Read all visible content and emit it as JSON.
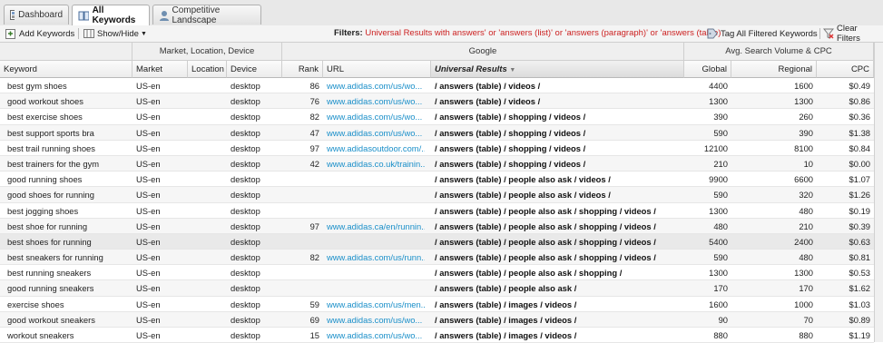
{
  "tabs": [
    {
      "label": "Dashboard",
      "icon": "dashboard-icon"
    },
    {
      "label": "All Keywords",
      "icon": "keywords-book-icon",
      "active": true
    },
    {
      "label": "Competitive Landscape",
      "icon": "competitive-landscape-icon"
    }
  ],
  "toolbar": {
    "add_keywords": "Add Keywords",
    "show_hide": "Show/Hide",
    "filters_label": "Filters:",
    "filters_value": "Universal Results with answers' or 'answers (list)' or 'answers (paragraph)' or 'answers (table)",
    "tag_all": "Tag All Filtered Keywords",
    "clear_filters": "Clear Filters"
  },
  "groups": {
    "market": "Market, Location, Device",
    "google": "Google",
    "volume": "Avg. Search Volume & CPC"
  },
  "columns": {
    "keyword": "Keyword",
    "market": "Market",
    "location": "Location",
    "device": "Device",
    "rank": "Rank",
    "url": "URL",
    "universal": "Universal Results",
    "global": "Global",
    "regional": "Regional",
    "cpc": "CPC"
  },
  "rows": [
    {
      "keyword": "best gym shoes",
      "market": "US-en",
      "location": "",
      "device": "desktop",
      "rank": "86",
      "url": "www.adidas.com/us/wo...",
      "universal": "/ answers (table) / videos /",
      "global": "4400",
      "regional": "1600",
      "cpc": "$0.49"
    },
    {
      "keyword": "good workout shoes",
      "market": "US-en",
      "location": "",
      "device": "desktop",
      "rank": "76",
      "url": "www.adidas.com/us/wo...",
      "universal": "/ answers (table) / videos /",
      "global": "1300",
      "regional": "1300",
      "cpc": "$0.86"
    },
    {
      "keyword": "best exercise shoes",
      "market": "US-en",
      "location": "",
      "device": "desktop",
      "rank": "82",
      "url": "www.adidas.com/us/wo...",
      "universal": "/ answers (table) / shopping / videos /",
      "global": "390",
      "regional": "260",
      "cpc": "$0.36"
    },
    {
      "keyword": "best support sports bra",
      "market": "US-en",
      "location": "",
      "device": "desktop",
      "rank": "47",
      "url": "www.adidas.com/us/wo...",
      "universal": "/ answers (table) / shopping / videos /",
      "global": "590",
      "regional": "390",
      "cpc": "$1.38"
    },
    {
      "keyword": "best trail running shoes",
      "market": "US-en",
      "location": "",
      "device": "desktop",
      "rank": "97",
      "url": "www.adidasoutdoor.com/...",
      "universal": "/ answers (table) / shopping / videos /",
      "global": "12100",
      "regional": "8100",
      "cpc": "$0.84"
    },
    {
      "keyword": "best trainers for the gym",
      "market": "US-en",
      "location": "",
      "device": "desktop",
      "rank": "42",
      "url": "www.adidas.co.uk/trainin...",
      "universal": "/ answers (table) / shopping / videos /",
      "global": "210",
      "regional": "10",
      "cpc": "$0.00"
    },
    {
      "keyword": "good running shoes",
      "market": "US-en",
      "location": "",
      "device": "desktop",
      "rank": "",
      "url": "",
      "universal": "/ answers (table) / people also ask / videos /",
      "global": "9900",
      "regional": "6600",
      "cpc": "$1.07"
    },
    {
      "keyword": "good shoes for running",
      "market": "US-en",
      "location": "",
      "device": "desktop",
      "rank": "",
      "url": "",
      "universal": "/ answers (table) / people also ask / videos /",
      "global": "590",
      "regional": "320",
      "cpc": "$1.26"
    },
    {
      "keyword": "best jogging shoes",
      "market": "US-en",
      "location": "",
      "device": "desktop",
      "rank": "",
      "url": "",
      "universal": "/ answers (table) / people also ask / shopping / videos /",
      "global": "1300",
      "regional": "480",
      "cpc": "$0.19"
    },
    {
      "keyword": "best shoe for running",
      "market": "US-en",
      "location": "",
      "device": "desktop",
      "rank": "97",
      "url": "www.adidas.ca/en/runnin...",
      "universal": "/ answers (table) / people also ask / shopping / videos /",
      "global": "480",
      "regional": "210",
      "cpc": "$0.39"
    },
    {
      "keyword": "best shoes for running",
      "market": "US-en",
      "location": "",
      "device": "desktop",
      "rank": "",
      "url": "",
      "universal": "/ answers (table) / people also ask / shopping / videos /",
      "global": "5400",
      "regional": "2400",
      "cpc": "$0.63"
    },
    {
      "keyword": "best sneakers for running",
      "market": "US-en",
      "location": "",
      "device": "desktop",
      "rank": "82",
      "url": "www.adidas.com/us/runn...",
      "universal": "/ answers (table) / people also ask / shopping / videos /",
      "global": "590",
      "regional": "480",
      "cpc": "$0.81"
    },
    {
      "keyword": "best running sneakers",
      "market": "US-en",
      "location": "",
      "device": "desktop",
      "rank": "",
      "url": "",
      "universal": "/ answers (table) / people also ask / shopping /",
      "global": "1300",
      "regional": "1300",
      "cpc": "$0.53"
    },
    {
      "keyword": "good running sneakers",
      "market": "US-en",
      "location": "",
      "device": "desktop",
      "rank": "",
      "url": "",
      "universal": "/ answers (table) / people also ask /",
      "global": "170",
      "regional": "170",
      "cpc": "$1.62"
    },
    {
      "keyword": "exercise shoes",
      "market": "US-en",
      "location": "",
      "device": "desktop",
      "rank": "59",
      "url": "www.adidas.com/us/men...",
      "universal": "/ answers (table) / images / videos /",
      "global": "1600",
      "regional": "1000",
      "cpc": "$1.03"
    },
    {
      "keyword": "good workout sneakers",
      "market": "US-en",
      "location": "",
      "device": "desktop",
      "rank": "69",
      "url": "www.adidas.com/us/wo...",
      "universal": "/ answers (table) / images / videos /",
      "global": "90",
      "regional": "70",
      "cpc": "$0.89"
    },
    {
      "keyword": "workout sneakers",
      "market": "US-en",
      "location": "",
      "device": "desktop",
      "rank": "15",
      "url": "www.adidas.com/us/wo...",
      "universal": "/ answers (table) / images / videos /",
      "global": "880",
      "regional": "880",
      "cpc": "$1.19"
    }
  ]
}
